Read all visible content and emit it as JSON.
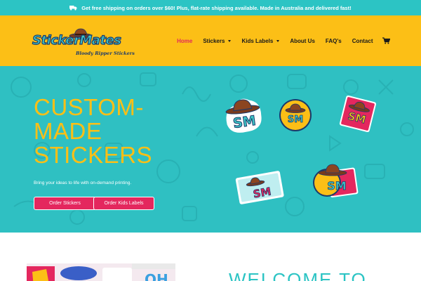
{
  "topbar": {
    "message": "Get free shipping on orders over $60! Plus, flat-rate shipping available. Made in Australia and delivered fast!",
    "icon": "truck-icon"
  },
  "logo": {
    "main": "StickerMates",
    "tagline": "Bloody Ripper Stickers"
  },
  "nav": {
    "items": [
      {
        "label": "Home",
        "active": true
      },
      {
        "label": "Stickers",
        "dropdown": true
      },
      {
        "label": "Kids Labels",
        "dropdown": true
      },
      {
        "label": "About Us"
      },
      {
        "label": "FAQ's"
      },
      {
        "label": "Contact"
      }
    ],
    "cart_icon": "cart-icon"
  },
  "hero": {
    "title_lines": [
      "CUSTOM-",
      "MADE",
      "STICKERS"
    ],
    "subtitle": "Bring your ideas to life with on-demand printing.",
    "button_primary": "Order Stickers",
    "button_secondary": "Order Kids Labels",
    "sticker_text": "SM"
  },
  "lower": {
    "heading": "WELCOME TO"
  },
  "colors": {
    "teal": "#2fc0c2",
    "yellow": "#fcbf16",
    "pink": "#e4275e",
    "navy": "#1b3a6b"
  }
}
